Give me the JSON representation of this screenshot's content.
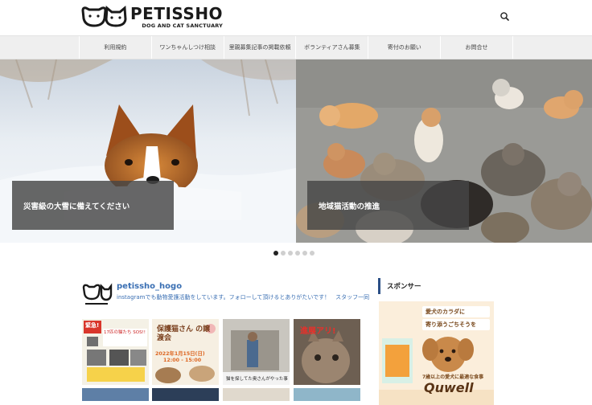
{
  "header": {
    "logo_name": "PETISSHO",
    "logo_tagline": "DOG AND CAT SANCTUARY",
    "search_icon": "search-icon"
  },
  "nav": {
    "items": [
      {
        "label": "利用規約"
      },
      {
        "label": "ワンちゃんしつけ相談"
      },
      {
        "label": "里親募集記事の掲載依頼"
      },
      {
        "label": "ボランティアさん募集"
      },
      {
        "label": "寄付のお願い"
      },
      {
        "label": "お問合せ"
      }
    ]
  },
  "slider": {
    "slides": [
      {
        "caption": "災害級の大雪に備えてください"
      },
      {
        "caption": "地域猫活動の推進"
      }
    ],
    "dot_count": 6,
    "active_index": 0
  },
  "instagram": {
    "username": "petissho_hogo",
    "description": "instagramでも動物愛護活動をしています。フォローして頂けるとありがたいです！　スタッフ一同",
    "tiles": [
      {
        "text": "緊急!",
        "sub": "17匹の猫たち SOS!!"
      },
      {
        "text": "保護猫さん の譲渡会",
        "sub": "2022年1月15日(日)",
        "time": "12:00 - 15:00"
      },
      {
        "text": "",
        "sub": "猫を探してた奥さんがやった事"
      },
      {
        "text": "進展アリ!",
        "sub": ""
      }
    ]
  },
  "sidebar": {
    "title": "スポンサー",
    "ad": {
      "headline_1": "愛犬のカラダに",
      "headline_2": "寄り添うごちそうを",
      "brand": "Quwell",
      "tagline": "7歳以上の愛犬に最適な食事"
    }
  },
  "colors": {
    "link": "#3a6fb3",
    "accent_bar": "#2b4f86",
    "caption_bg": "#464646"
  }
}
